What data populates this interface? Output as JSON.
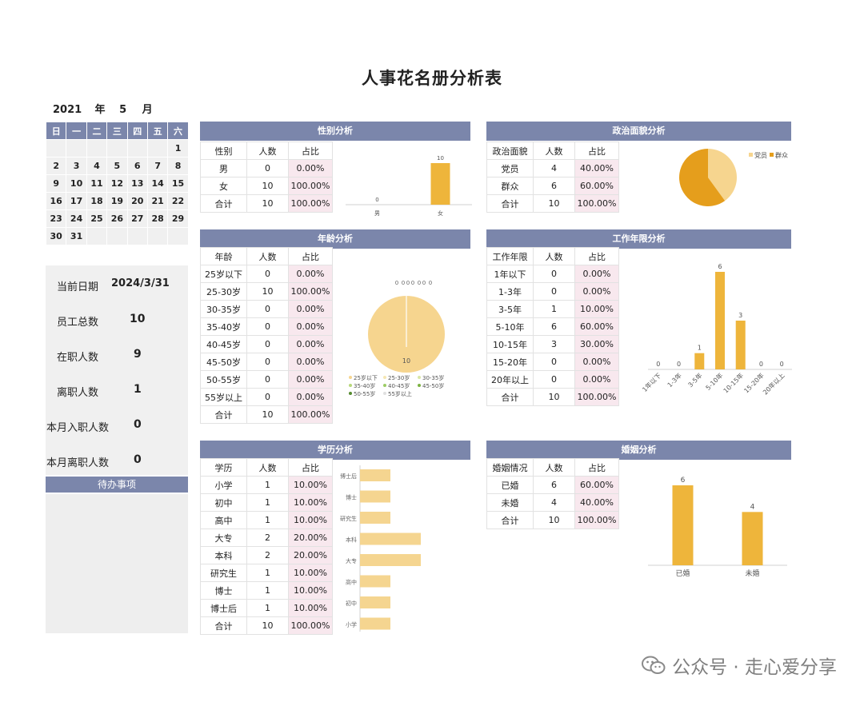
{
  "title": "人事花名册分析表",
  "calendar": {
    "year": "2021",
    "year_unit": "年",
    "month": "5",
    "month_unit": "月",
    "weekdays": [
      "日",
      "一",
      "二",
      "三",
      "四",
      "五",
      "六"
    ],
    "weeks": [
      [
        "",
        "",
        "",
        "",
        "",
        "",
        "1"
      ],
      [
        "2",
        "3",
        "4",
        "5",
        "6",
        "7",
        "8"
      ],
      [
        "9",
        "10",
        "11",
        "12",
        "13",
        "14",
        "15"
      ],
      [
        "16",
        "17",
        "18",
        "19",
        "20",
        "21",
        "22"
      ],
      [
        "23",
        "24",
        "25",
        "26",
        "27",
        "28",
        "29"
      ],
      [
        "30",
        "31",
        "",
        "",
        "",
        "",
        ""
      ]
    ]
  },
  "info": {
    "current_date_label": "当前日期",
    "current_date": "2024/3/31",
    "total_employees_label": "员工总数",
    "total_employees": "10",
    "active_label": "在职人数",
    "active": "9",
    "left_label": "离职人数",
    "left": "1",
    "month_hired_label": "本月入职人数",
    "month_hired": "0",
    "month_left_label": "本月离职人数",
    "month_left": "0",
    "todo_label": "待办事项"
  },
  "gender": {
    "header": "性别分析",
    "columns": [
      "性别",
      "人数",
      "占比"
    ],
    "rows": [
      [
        "男",
        "0",
        "0.00%"
      ],
      [
        "女",
        "10",
        "100.00%"
      ],
      [
        "合计",
        "10",
        "100.00%"
      ]
    ]
  },
  "politics": {
    "header": "政治面貌分析",
    "columns": [
      "政治面貌",
      "人数",
      "占比"
    ],
    "rows": [
      [
        "党员",
        "4",
        "40.00%"
      ],
      [
        "群众",
        "6",
        "60.00%"
      ],
      [
        "合计",
        "10",
        "100.00%"
      ]
    ]
  },
  "age": {
    "header": "年龄分析",
    "columns": [
      "年龄",
      "人数",
      "占比"
    ],
    "rows": [
      [
        "25岁以下",
        "0",
        "0.00%"
      ],
      [
        "25-30岁",
        "10",
        "100.00%"
      ],
      [
        "30-35岁",
        "0",
        "0.00%"
      ],
      [
        "35-40岁",
        "0",
        "0.00%"
      ],
      [
        "40-45岁",
        "0",
        "0.00%"
      ],
      [
        "45-50岁",
        "0",
        "0.00%"
      ],
      [
        "50-55岁",
        "0",
        "0.00%"
      ],
      [
        "55岁以上",
        "0",
        "0.00%"
      ],
      [
        "合计",
        "10",
        "100.00%"
      ]
    ]
  },
  "tenure": {
    "header": "工作年限分析",
    "columns": [
      "工作年限",
      "人数",
      "占比"
    ],
    "rows": [
      [
        "1年以下",
        "0",
        "0.00%"
      ],
      [
        "1-3年",
        "0",
        "0.00%"
      ],
      [
        "3-5年",
        "1",
        "10.00%"
      ],
      [
        "5-10年",
        "6",
        "60.00%"
      ],
      [
        "10-15年",
        "3",
        "30.00%"
      ],
      [
        "15-20年",
        "0",
        "0.00%"
      ],
      [
        "20年以上",
        "0",
        "0.00%"
      ],
      [
        "合计",
        "10",
        "100.00%"
      ]
    ]
  },
  "education": {
    "header": "学历分析",
    "columns": [
      "学历",
      "人数",
      "占比"
    ],
    "rows": [
      [
        "小学",
        "1",
        "10.00%"
      ],
      [
        "初中",
        "1",
        "10.00%"
      ],
      [
        "高中",
        "1",
        "10.00%"
      ],
      [
        "大专",
        "2",
        "20.00%"
      ],
      [
        "本科",
        "2",
        "20.00%"
      ],
      [
        "研究生",
        "1",
        "10.00%"
      ],
      [
        "博士",
        "1",
        "10.00%"
      ],
      [
        "博士后",
        "1",
        "10.00%"
      ],
      [
        "合计",
        "10",
        "100.00%"
      ]
    ]
  },
  "marriage": {
    "header": "婚姻分析",
    "columns": [
      "婚姻情况",
      "人数",
      "占比"
    ],
    "rows": [
      [
        "已婚",
        "6",
        "60.00%"
      ],
      [
        "未婚",
        "4",
        "40.00%"
      ],
      [
        "合计",
        "10",
        "100.00%"
      ]
    ]
  },
  "colors": {
    "header_bar": "#7b86ab",
    "bar_gold": "#eeb53b",
    "bar_light": "#f5d590",
    "pie_dark": "#e59e1c",
    "pie_light": "#f6d58f",
    "highlight": "#f8e8ee"
  },
  "chart_data": [
    {
      "type": "bar",
      "categories": [
        "男",
        "女"
      ],
      "values": [
        0,
        10
      ],
      "data_labels": true
    },
    {
      "type": "pie",
      "categories": [
        "党员",
        "群众"
      ],
      "values": [
        4,
        6
      ],
      "legend": "top-right"
    },
    {
      "type": "pie",
      "categories": [
        "25岁以下",
        "25-30岁",
        "30-35岁",
        "35-40岁",
        "40-45岁",
        "45-50岁",
        "50-55岁",
        "55岁以上"
      ],
      "values": [
        0,
        10,
        0,
        0,
        0,
        0,
        0,
        0
      ],
      "legend": "bottom"
    },
    {
      "type": "bar",
      "categories": [
        "1年以下",
        "1-3年",
        "3-5年",
        "5-10年",
        "10-15年",
        "15-20年",
        "20年以上"
      ],
      "values": [
        0,
        0,
        1,
        6,
        3,
        0,
        0
      ],
      "data_labels": true
    },
    {
      "type": "bar",
      "orientation": "horizontal",
      "categories": [
        "小学",
        "初中",
        "高中",
        "大专",
        "本科",
        "研究生",
        "博士",
        "博士后"
      ],
      "values": [
        1,
        1,
        1,
        2,
        2,
        1,
        1,
        1
      ]
    },
    {
      "type": "bar",
      "categories": [
        "已婚",
        "未婚"
      ],
      "values": [
        6,
        4
      ],
      "data_labels": true
    }
  ],
  "watermark": {
    "text": "公众号 · 走心爱分享",
    "icon": "wechat-icon"
  }
}
